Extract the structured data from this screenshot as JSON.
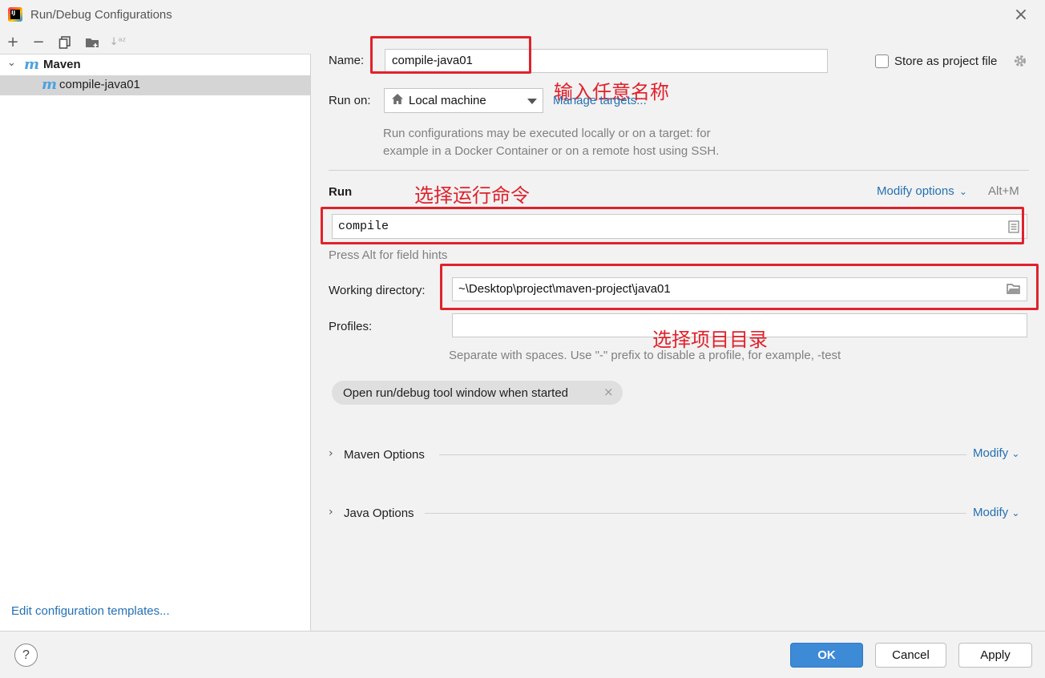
{
  "window": {
    "title": "Run/Debug Configurations"
  },
  "left": {
    "toolbar_icons": [
      "add-icon",
      "remove-icon",
      "copy-icon",
      "new-folder-icon",
      "sort-icon"
    ],
    "tree": {
      "group_label": "Maven",
      "item_label": "compile-java01"
    },
    "edit_templates_link": "Edit configuration templates..."
  },
  "form": {
    "name_label": "Name:",
    "name_value": "compile-java01",
    "store_label": "Store as project file",
    "run_on_label": "Run on:",
    "run_on_value": "Local machine",
    "manage_targets": "Manage targets...",
    "run_on_hint_line1": "Run configurations may be executed locally or on a target: for",
    "run_on_hint_line2": "example in a Docker Container or on a remote host using SSH.",
    "run_section_title": "Run",
    "modify_options": "Modify options",
    "modify_shortcut": "Alt+M",
    "command_value": "compile",
    "field_hint": "Press Alt for field hints",
    "workdir_label": "Working directory:",
    "workdir_value": "~\\Desktop\\project\\maven-project\\java01",
    "profiles_label": "Profiles:",
    "profiles_value": "",
    "profiles_hint": "Separate with spaces. Use \"-\" prefix to disable a profile, for example, -test",
    "chip_label": "Open run/debug tool window when started",
    "maven_options": "Maven Options",
    "java_options": "Java Options",
    "modify_label": "Modify"
  },
  "annotations": {
    "name_note": "输入任意名称",
    "run_note": "选择运行命令",
    "dir_note": "选择项目目录"
  },
  "buttons": {
    "help": "?",
    "ok": "OK",
    "cancel": "Cancel",
    "apply": "Apply"
  },
  "colors": {
    "accent": "#3d8ad6",
    "link": "#2470b3",
    "annotation": "#e0222c"
  }
}
